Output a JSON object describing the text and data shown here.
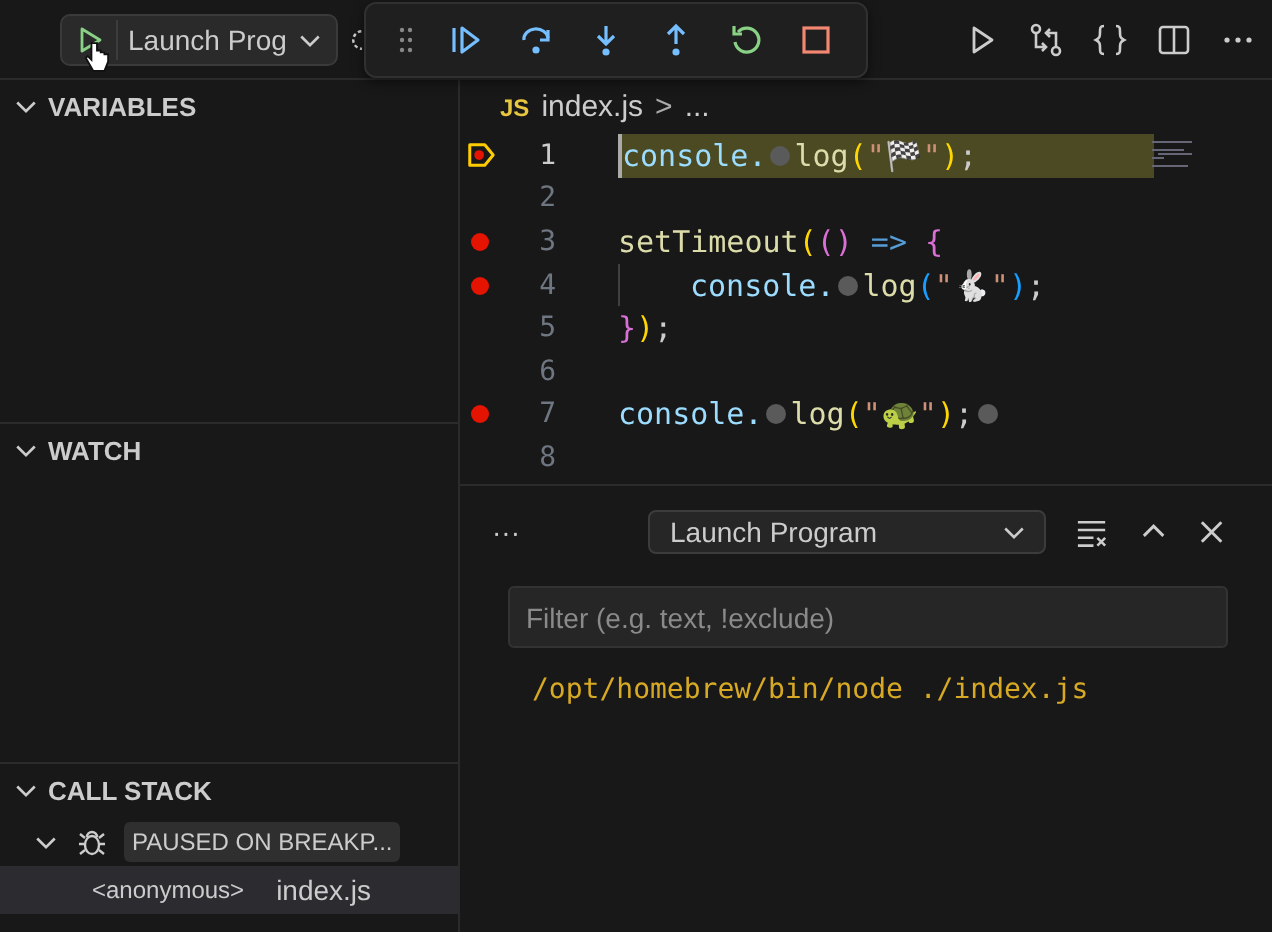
{
  "top_bar": {
    "launch_config": "Launch Prog"
  },
  "sidebar": {
    "sections": [
      {
        "title": "VARIABLES",
        "expanded": true
      },
      {
        "title": "WATCH",
        "expanded": true
      },
      {
        "title": "CALL STACK",
        "expanded": true
      }
    ],
    "call_stack": {
      "session": "PAUSED ON BREAKP...",
      "frames": [
        {
          "name": "<anonymous>",
          "file": "index.js",
          "selected": true
        }
      ]
    }
  },
  "editor": {
    "breadcrumb": {
      "file_badge": "JS",
      "file": "index.js",
      "separator": ">",
      "rest": "..."
    },
    "lines": [
      {
        "number": "1",
        "breakpoint": true,
        "paused": true,
        "tokens": [
          {
            "kind": "var",
            "text": "console."
          },
          {
            "kind": "inlay"
          },
          {
            "kind": "fn",
            "text": "log"
          },
          {
            "kind": "b1",
            "text": "("
          },
          {
            "kind": "str",
            "text": "\"🏁\""
          },
          {
            "kind": "b1",
            "text": ")"
          },
          {
            "kind": "punct",
            "text": ";"
          }
        ]
      },
      {
        "number": "2",
        "breakpoint": false,
        "paused": false
      },
      {
        "number": "3",
        "breakpoint": true,
        "paused": false,
        "tokens": [
          {
            "kind": "fn",
            "text": "setTimeout"
          },
          {
            "kind": "b1",
            "text": "("
          },
          {
            "kind": "b2",
            "text": "()"
          },
          {
            "kind": "kw",
            "text": " => "
          },
          {
            "kind": "b2",
            "text": "{"
          }
        ]
      },
      {
        "number": "4",
        "breakpoint": true,
        "paused": false,
        "tokens": [
          {
            "kind": "indent"
          },
          {
            "kind": "var",
            "text": "console."
          },
          {
            "kind": "inlay"
          },
          {
            "kind": "fn",
            "text": "log"
          },
          {
            "kind": "b3",
            "text": "("
          },
          {
            "kind": "str",
            "text": "\"🐇\""
          },
          {
            "kind": "b3",
            "text": ")"
          },
          {
            "kind": "punct",
            "text": ";"
          }
        ]
      },
      {
        "number": "5",
        "breakpoint": false,
        "paused": false,
        "tokens": [
          {
            "kind": "b2",
            "text": "}"
          },
          {
            "kind": "b1",
            "text": ")"
          },
          {
            "kind": "punct",
            "text": ";"
          }
        ]
      },
      {
        "number": "6",
        "breakpoint": false,
        "paused": false
      },
      {
        "number": "7",
        "breakpoint": true,
        "paused": false,
        "tokens": [
          {
            "kind": "var",
            "text": "console."
          },
          {
            "kind": "inlay"
          },
          {
            "kind": "fn",
            "text": "log"
          },
          {
            "kind": "b1",
            "text": "("
          },
          {
            "kind": "str",
            "text": "\"🐢\""
          },
          {
            "kind": "b1",
            "text": ")"
          },
          {
            "kind": "punct",
            "text": ";"
          },
          {
            "kind": "inlay"
          }
        ]
      },
      {
        "number": "8",
        "breakpoint": false,
        "paused": false
      }
    ]
  },
  "panel": {
    "more": "···",
    "session_select": "Launch Program",
    "filter": {
      "placeholder": "Filter (e.g. text, !exclude)"
    },
    "output": [
      "/opt/homebrew/bin/node ./index.js"
    ]
  }
}
